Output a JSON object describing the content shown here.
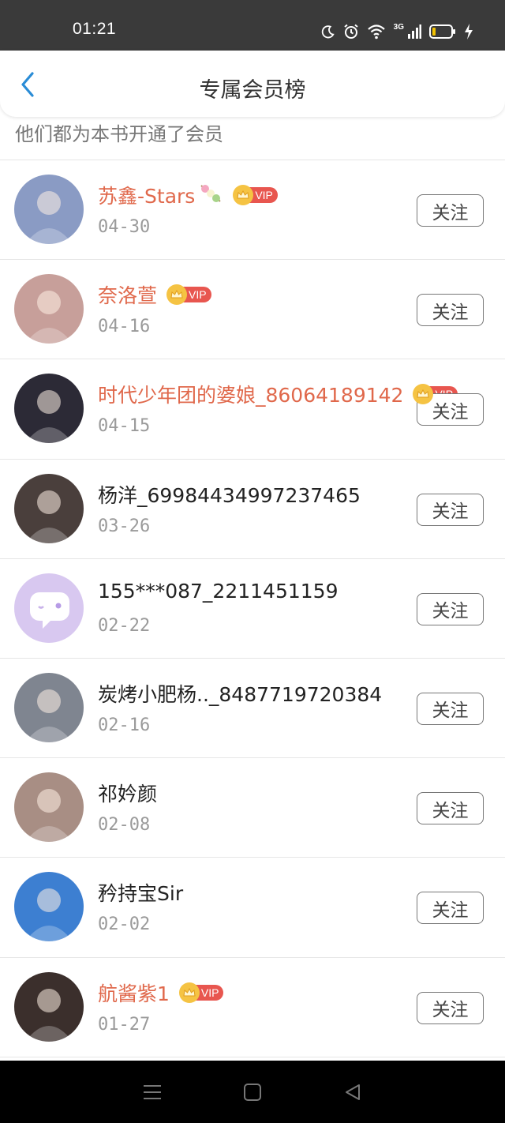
{
  "status_bar": {
    "time": "01:21",
    "network": "3G",
    "icons": [
      "moon-icon",
      "alarm-icon",
      "wifi-icon",
      "signal-icon",
      "battery-icon",
      "charging-icon"
    ]
  },
  "header": {
    "title": "专属会员榜",
    "back_icon": "chevron-left-icon"
  },
  "subtitle": "他们都为本书开通了会员",
  "vip_label": "VIP",
  "follow_label": "关注",
  "members": [
    {
      "name": "苏鑫-Stars",
      "date": "04-30",
      "vip": true,
      "emoji": true,
      "avatar": "#8a9bc4"
    },
    {
      "name": "奈洛萱",
      "date": "04-16",
      "vip": true,
      "emoji": false,
      "avatar": "#c79f9a"
    },
    {
      "name": "时代少年团的婆娘_86064189142",
      "date": "04-15",
      "vip": true,
      "emoji": false,
      "avatar": "#2c2a36"
    },
    {
      "name": "杨洋_69984434997237465",
      "date": "03-26",
      "vip": false,
      "emoji": false,
      "avatar": "#4a3f3c"
    },
    {
      "name": "155***087_2211451159",
      "date": "02-22",
      "vip": false,
      "emoji": false,
      "avatar": "#d8c8f0"
    },
    {
      "name": "炭烤小肥杨.._8487719720384",
      "date": "02-16",
      "vip": false,
      "emoji": false,
      "avatar": "#7f8590"
    },
    {
      "name": "祁妗颜",
      "date": "02-08",
      "vip": false,
      "emoji": false,
      "avatar": "#a88e84"
    },
    {
      "name": "矜持宝Sir",
      "date": "02-02",
      "vip": false,
      "emoji": false,
      "avatar": "#3d7fd1"
    },
    {
      "name": "航酱紫1",
      "date": "01-27",
      "vip": true,
      "emoji": false,
      "avatar": "#3b2f2c"
    }
  ],
  "nav_bar": {
    "icons": [
      "menu-icon",
      "home-square-icon",
      "back-triangle-icon"
    ]
  },
  "colors": {
    "vip_name": "#e0684b",
    "vip_badge": "#e8564f",
    "crown": "#f5c343",
    "accent": "#2a8cd6"
  }
}
